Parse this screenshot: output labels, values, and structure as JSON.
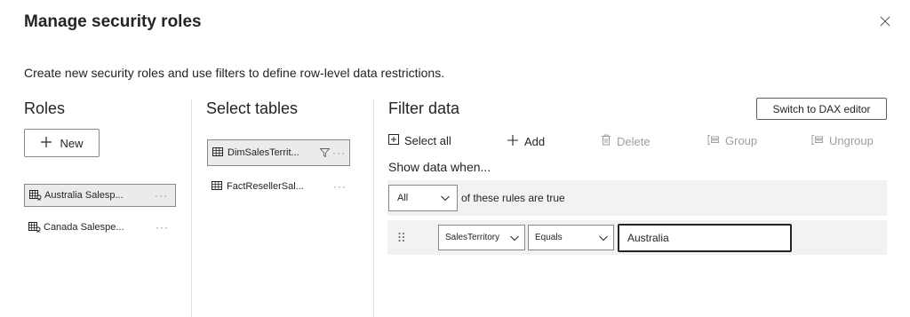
{
  "dialog": {
    "title": "Manage security roles",
    "subtitle": "Create new security roles and use filters to define row-level data restrictions."
  },
  "roles": {
    "title": "Roles",
    "new_label": "New",
    "items": [
      {
        "label": "Australia Salesp...",
        "selected": true
      },
      {
        "label": "Canada Salespe...",
        "selected": false
      }
    ],
    "more_label": "···"
  },
  "tables": {
    "title": "Select tables",
    "items": [
      {
        "label": "DimSalesTerrit...",
        "selected": true,
        "filtered": true
      },
      {
        "label": "FactResellerSal...",
        "selected": false,
        "filtered": false
      }
    ],
    "more_label": "···"
  },
  "filter": {
    "title": "Filter data",
    "switch_label": "Switch to DAX editor",
    "toolbar": {
      "select_all": "Select all",
      "add": "Add",
      "delete": "Delete",
      "group": "Group",
      "ungroup": "Ungroup"
    },
    "show_when": "Show data when...",
    "match_mode": "All",
    "rules_label": "of these rules are true",
    "rule": {
      "column": "SalesTerritory",
      "operator": "Equals",
      "value": "Australia"
    }
  },
  "colors": {
    "text": "#252423",
    "disabled": "#a19f9d",
    "border": "#8a8886",
    "row_bg": "#f3f2f1",
    "selected_bg": "#edebe9"
  },
  "icons": [
    "close-icon",
    "plus-icon",
    "role-icon",
    "table-icon",
    "filter-icon",
    "select-all-icon",
    "delete-icon",
    "group-icon",
    "ungroup-icon",
    "chevron-down-icon",
    "drag-handle-icon"
  ]
}
